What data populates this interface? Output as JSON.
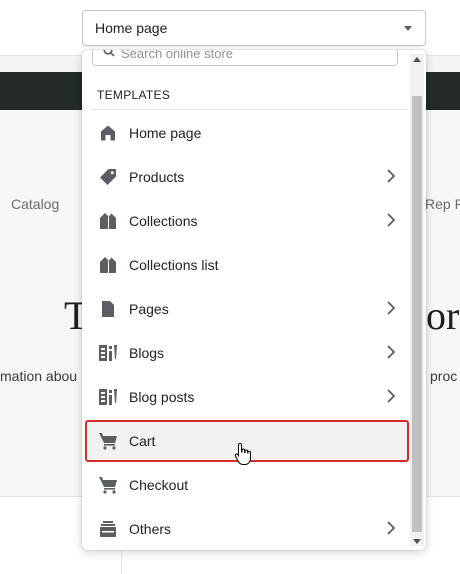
{
  "page_background": {
    "nav_left": "Catalog",
    "nav_right": "Rep P",
    "heading_left": "T",
    "heading_right": "ora",
    "body_left": "mation abou",
    "body_right": "proc"
  },
  "template_select": {
    "value": "Home page"
  },
  "dropdown": {
    "search_placeholder": "Search online store",
    "section_title": "TEMPLATES",
    "items": [
      {
        "label": "Home page",
        "icon": "home-icon",
        "has_submenu": false
      },
      {
        "label": "Products",
        "icon": "tag-icon",
        "has_submenu": true
      },
      {
        "label": "Collections",
        "icon": "collections-icon",
        "has_submenu": true
      },
      {
        "label": "Collections list",
        "icon": "collections-icon",
        "has_submenu": false
      },
      {
        "label": "Pages",
        "icon": "page-icon",
        "has_submenu": true
      },
      {
        "label": "Blogs",
        "icon": "blog-icon",
        "has_submenu": true
      },
      {
        "label": "Blog posts",
        "icon": "blog-icon",
        "has_submenu": true
      },
      {
        "label": "Cart",
        "icon": "cart-icon",
        "has_submenu": false,
        "highlighted": true
      },
      {
        "label": "Checkout",
        "icon": "cart-icon",
        "has_submenu": false
      },
      {
        "label": "Others",
        "icon": "stack-icon",
        "has_submenu": true
      }
    ]
  },
  "colors": {
    "highlight_border": "#d72c2c",
    "icon": "#5c5f62",
    "dark_band": "#232a27"
  }
}
